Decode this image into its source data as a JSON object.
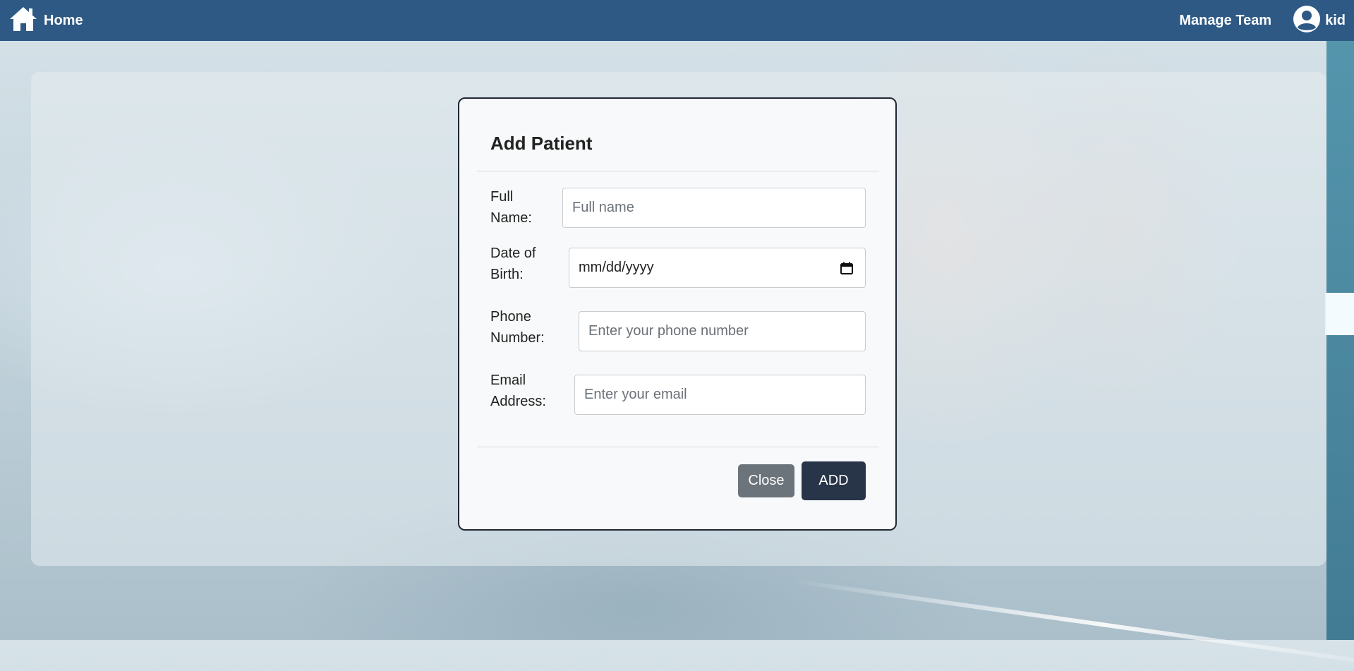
{
  "nav": {
    "home_label": "Home",
    "home_icon": "house-icon",
    "manage_label": "Manage Team",
    "user_label": "kid",
    "user_icon": "user-circle-icon",
    "bar_color": "#2e5985"
  },
  "modal": {
    "title": "Add Patient",
    "fields": [
      {
        "label_line1": "Full",
        "label_line2": "Name:",
        "placeholder": "Full name",
        "value": ""
      },
      {
        "label_line1": "Date of",
        "label_line2": "Birth:",
        "placeholder": "mm/dd/yyyy",
        "value": ""
      },
      {
        "label_line1": "Phone",
        "label_line2": "Number:",
        "placeholder": "Enter your phone number",
        "value": ""
      },
      {
        "label_line1": "Email",
        "label_line2": "Address:",
        "placeholder": "Enter your email",
        "value": ""
      }
    ],
    "date_icon": "calendar-icon",
    "close_label": "Close",
    "add_label": "ADD",
    "close_color": "#6b737b",
    "add_color": "#283549"
  }
}
